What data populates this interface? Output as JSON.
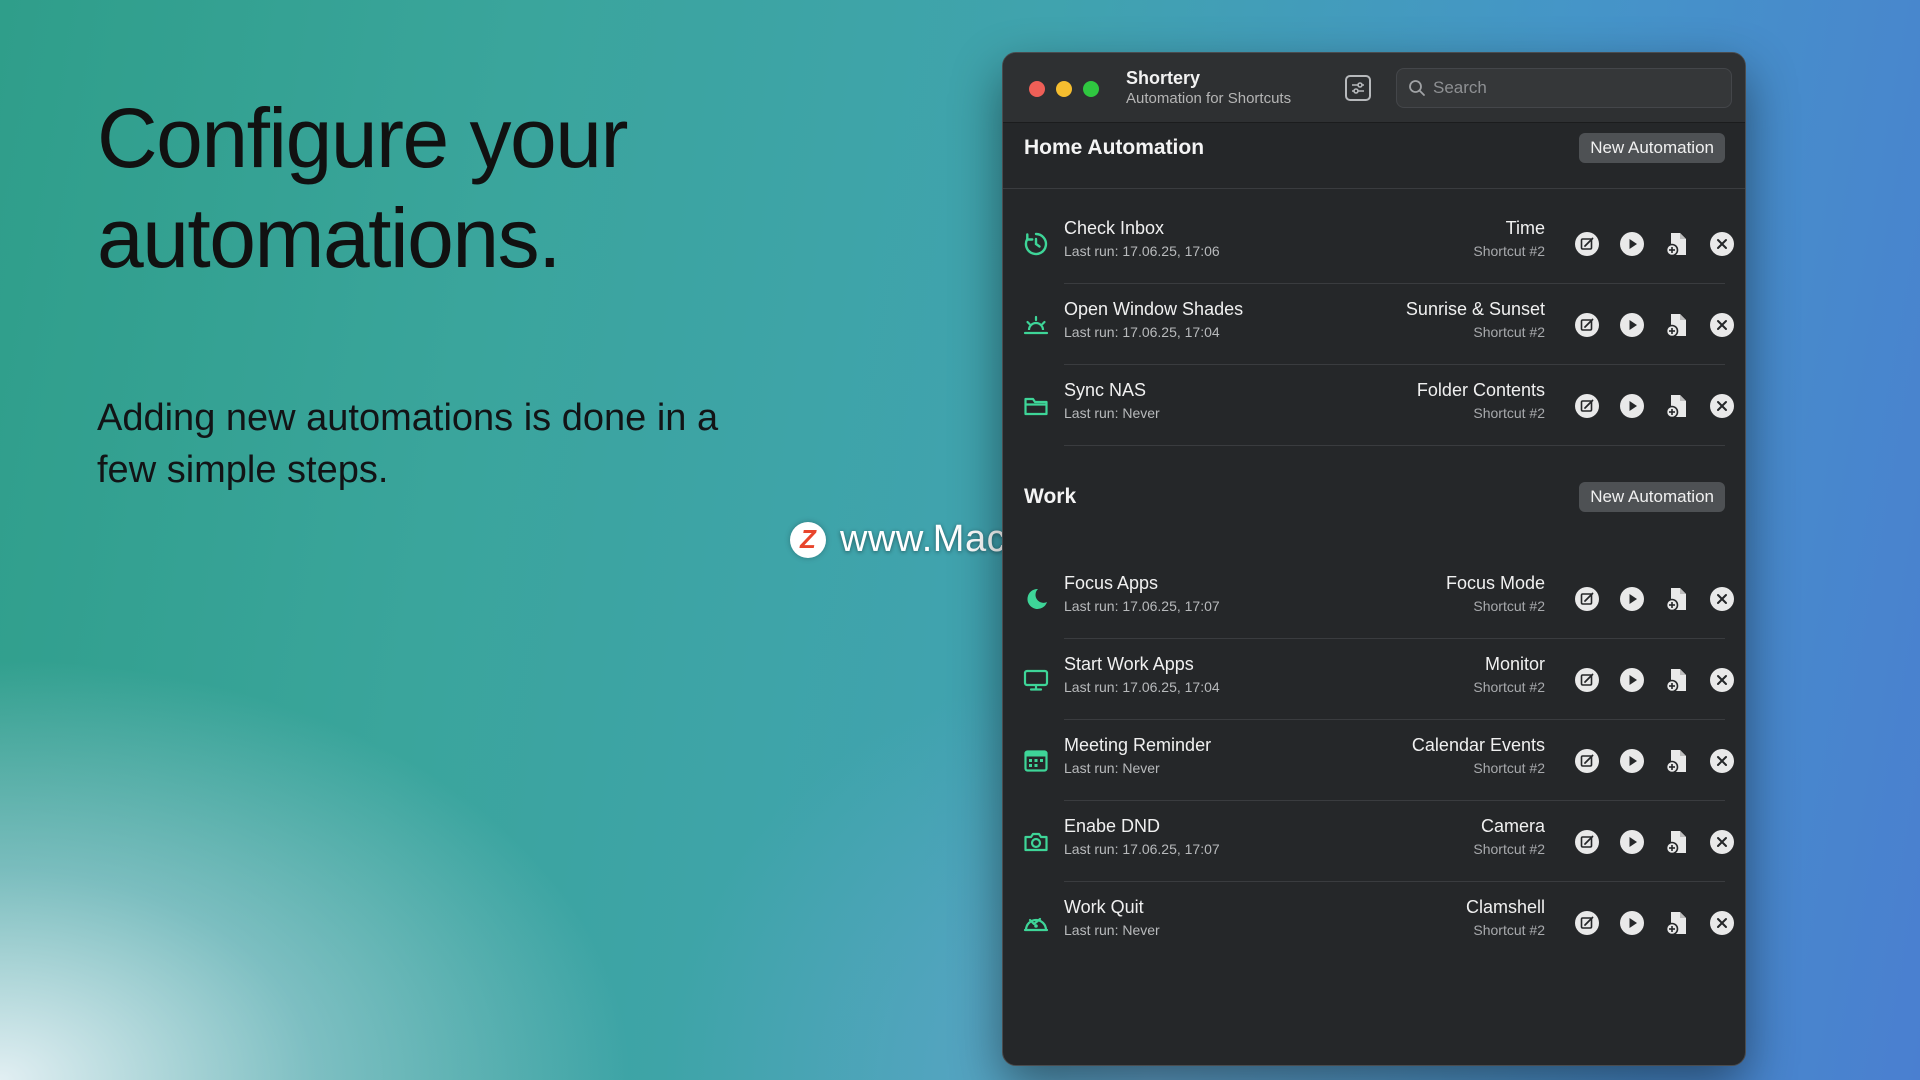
{
  "hero": {
    "title": "Configure your automations.",
    "subtitle": "Adding new automations is done in a few simple steps."
  },
  "watermark": {
    "logo": "Z",
    "text": "www.MacZ.com"
  },
  "app": {
    "title": "Shortery",
    "subtitle": "Automation for Shortcuts",
    "search_placeholder": "Search",
    "accent_color": "#3ed598"
  },
  "sections": [
    {
      "title": "Home Automation",
      "button_label": "New Automation",
      "rows": [
        {
          "name": "Check Inbox",
          "last_run": "Last run: 17.06.25, 17:06",
          "trigger": "Time",
          "shortcut": "Shortcut #2",
          "icon": "timer-icon"
        },
        {
          "name": "Open Window Shades",
          "last_run": "Last run: 17.06.25, 17:04",
          "trigger": "Sunrise & Sunset",
          "shortcut": "Shortcut #2",
          "icon": "sunrise-icon"
        },
        {
          "name": "Sync NAS",
          "last_run": "Last run: Never",
          "trigger": "Folder Contents",
          "shortcut": "Shortcut #2",
          "icon": "folder-icon"
        }
      ]
    },
    {
      "title": "Work",
      "button_label": "New Automation",
      "rows": [
        {
          "name": "Focus Apps",
          "last_run": "Last run: 17.06.25, 17:07",
          "trigger": "Focus Mode",
          "shortcut": "Shortcut #2",
          "icon": "moon-icon"
        },
        {
          "name": "Start Work Apps",
          "last_run": "Last run: 17.06.25, 17:04",
          "trigger": "Monitor",
          "shortcut": "Shortcut #2",
          "icon": "monitor-icon"
        },
        {
          "name": "Meeting Reminder",
          "last_run": "Last run: Never",
          "trigger": "Calendar Events",
          "shortcut": "Shortcut #2",
          "icon": "calendar-icon"
        },
        {
          "name": "Enabe DND",
          "last_run": "Last run: 17.06.25, 17:07",
          "trigger": "Camera",
          "shortcut": "Shortcut #2",
          "icon": "camera-icon"
        },
        {
          "name": "Work Quit",
          "last_run": "Last run: Never",
          "trigger": "Clamshell",
          "shortcut": "Shortcut #2",
          "icon": "clamshell-icon"
        }
      ]
    }
  ]
}
